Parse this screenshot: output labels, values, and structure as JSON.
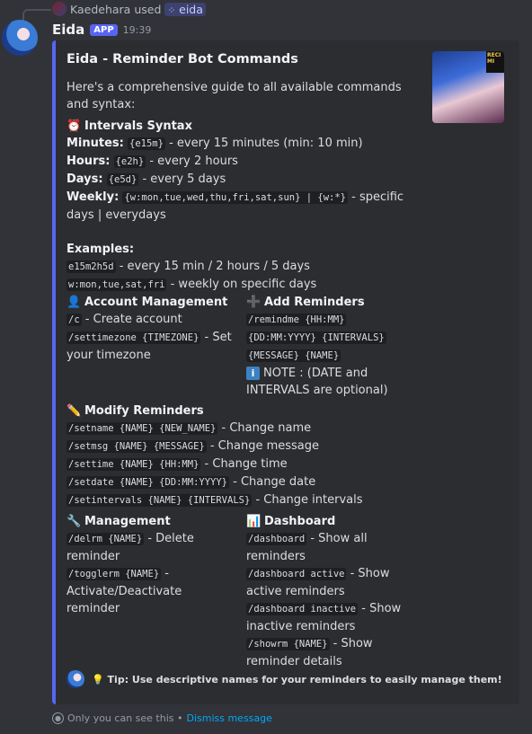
{
  "reply": {
    "user": "Kaedehara",
    "action": "used",
    "command": "eida"
  },
  "message": {
    "author": "Eida",
    "tag": "APP",
    "time": "19:39"
  },
  "embed": {
    "title": "Eida - Reminder Bot Commands",
    "description": "Here's a comprehensive guide to all available commands and syntax:",
    "thumbnail_badge": "RECI\nMI",
    "intervals": {
      "emoji": "⏰",
      "name": "Intervals Syntax",
      "minutes_label": "Minutes:",
      "minutes_code": "{e15m}",
      "minutes_text": "- every 15 minutes (min: 10 min)",
      "hours_label": "Hours:",
      "hours_code": "{e2h}",
      "hours_text": "- every 2 hours",
      "days_label": "Days:",
      "days_code": "{e5d}",
      "days_text": "- every 5 days",
      "weekly_label": "Weekly:",
      "weekly_code": "{w:mon,tue,wed,thu,fri,sat,sun} | {w:*}",
      "weekly_text": "- specific days | everydays",
      "examples_label": "Examples:",
      "ex1_code": "e15m2h5d",
      "ex1_text": "- every 15 min / 2 hours / 5 days",
      "ex2_code": "w:mon,tue,sat,fri",
      "ex2_text": "- weekly on specific days"
    },
    "account": {
      "emoji": "👤",
      "name": "Account Management",
      "c_code": "/c",
      "c_text": "- Create account",
      "tz_code": "/settimezone {TIMEZONE}",
      "tz_text": "- Set your timezone"
    },
    "add": {
      "emoji": "➕",
      "name": "Add Reminders",
      "cmd1": "/remindme {HH:MM}",
      "cmd2": "{DD:MM:YYYY} {INTERVALS}",
      "cmd3": "{MESSAGE} {NAME}",
      "note_icon": "i",
      "note": "NOTE : (DATE and INTERVALS are optional)"
    },
    "modify": {
      "emoji": "✏️",
      "name": "Modify Reminders",
      "rows": [
        {
          "code": "/setname {NAME} {NEW_NAME}",
          "text": "- Change name"
        },
        {
          "code": "/setmsg {NAME} {MESSAGE}",
          "text": "- Change message"
        },
        {
          "code": "/settime {NAME} {HH:MM}",
          "text": "- Change time"
        },
        {
          "code": "/setdate {NAME} {DD:MM:YYYY}",
          "text": "- Change date"
        },
        {
          "code": "/setintervals {NAME} {INTERVALS}",
          "text": "- Change intervals"
        }
      ]
    },
    "management": {
      "emoji": "🔧",
      "name": "Management",
      "delrm_code": "/delrm {NAME}",
      "delrm_text": "- Delete reminder",
      "toggle_code": "/togglerm {NAME}",
      "toggle_text": "- Activate/Deactivate reminder"
    },
    "dashboard": {
      "emoji": "📊",
      "name": "Dashboard",
      "d1_code": "/dashboard",
      "d1_text": "- Show all reminders",
      "d2_code": "/dashboard active",
      "d2_text": "- Show active reminders",
      "d3_code": "/dashboard inactive",
      "d3_text": "- Show inactive reminders",
      "d4_code": "/showrm {NAME}",
      "d4_text": "- Show reminder details"
    },
    "footer": {
      "emoji": "💡",
      "text": "Tip: Use descriptive names for your reminders to easily manage them!"
    }
  },
  "ephemeral": {
    "text": "Only you can see this •",
    "link": "Dismiss message"
  },
  "colors": {
    "background": "#313338",
    "embed_bg": "#2b2d31",
    "accent": "#5865f2",
    "link": "#00a8fc"
  }
}
